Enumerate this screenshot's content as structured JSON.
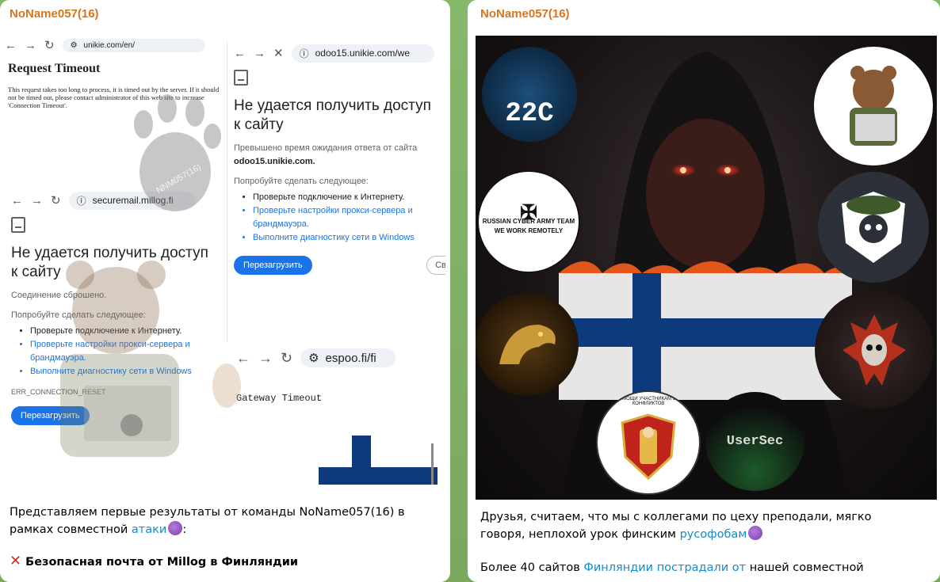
{
  "left_post": {
    "author": "NoName057(16)",
    "screenshots": {
      "unikie_en": {
        "url": "unikie.com/en/",
        "title": "Request Timeout",
        "body": "This request takes too long to process, it is timed out by the server. If it should not be timed out, please contact administrator of this web site to increase 'Connection Timeout'."
      },
      "odoo": {
        "url": "odoo15.unikie.com/we",
        "heading": "Не удается получить доступ к сайту",
        "line1": "Превышено время ожидания ответа от сайта",
        "host": "odoo15.unikie.com.",
        "try_label": "Попробуйте сделать следующее:",
        "tips": [
          "Проверьте подключение к Интернету.",
          "Проверьте настройки прокси-сервера и брандмауэра.",
          "Выполните диагностику сети в Windows"
        ],
        "reload": "Перезагрузить",
        "secondary": "Св"
      },
      "millog": {
        "url": "securemail.millog.fi",
        "heading": "Не удается получить доступ к сайту",
        "line1": "Соединение сброшено.",
        "try_label": "Попробуйте сделать следующее:",
        "tips": [
          "Проверьте подключение к Интернету.",
          "Проверьте настройки прокси-сервера и брандмауэра.",
          "Выполните диагностику сети в Windows"
        ],
        "error_code": "ERR_CONNECTION_RESET",
        "reload": "Перезагрузить"
      },
      "espoo": {
        "url": "espoo.fi/fi",
        "message": "Gateway Timeout"
      }
    },
    "watermark": "NNM057(16)",
    "caption_line1": "Представляем первые результаты от команды NoName057(16) в",
    "caption_line2_prefix": "рамках совместной",
    "caption_link": "атаки",
    "caption_line2_suffix": ":",
    "target_line": "Безопасная почта от Millog в Финляндии"
  },
  "right_post": {
    "author": "NoName057(16)",
    "logos": {
      "c22": "22C",
      "russian": "RUSSIAN CYBER ARMY TEAM",
      "remote": "WE WORK REMOTELY",
      "usersec": "UserSec",
      "fund": "ФОНД ПОМОЩИ УЧАСТНИКАМ ВОЕННЫХ КОНФЛИКТОВ"
    },
    "caption_line1": "Друзья, считаем, что мы с коллегами по цеху преподали, мягко",
    "caption_line2_prefix": "говоря, неплохой урок финским",
    "caption_link": "русофобам",
    "caption_line3_prefix": "Более 40 сайтов",
    "caption_link2": "Финляндии пострадали от",
    "caption_line3_suffix": "нашей совместной"
  },
  "colors": {
    "background": "#7fae63",
    "author": "#d9741d",
    "link": "#168acd",
    "chrome_blue": "#1a73e8",
    "finland_blue": "#0d3a7c"
  }
}
